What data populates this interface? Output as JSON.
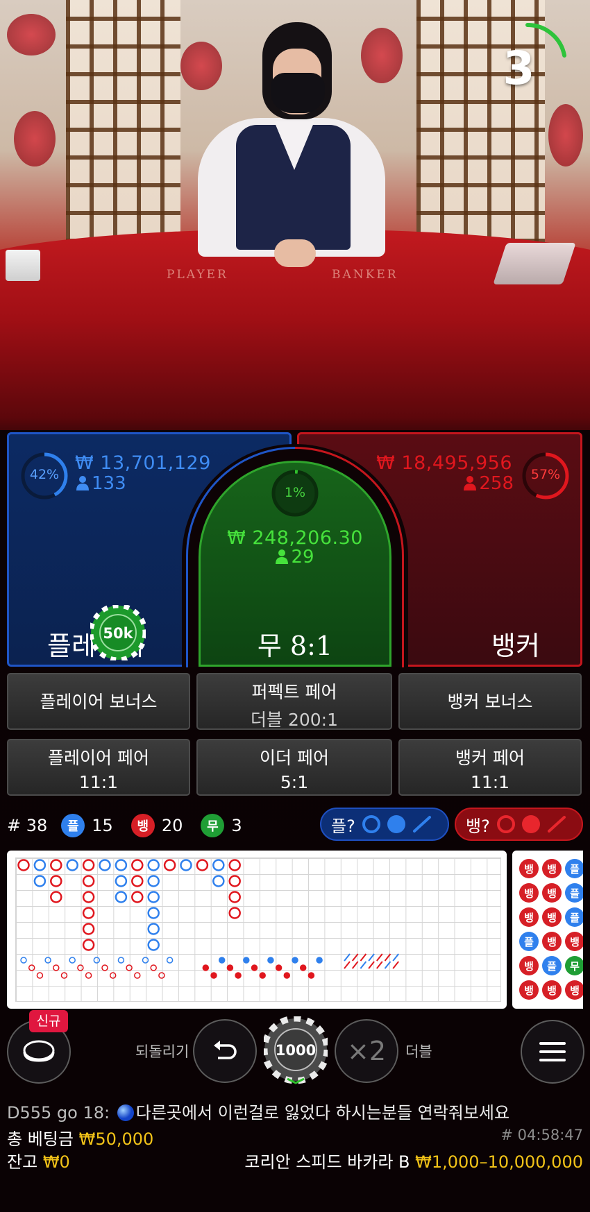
{
  "timer": {
    "seconds": "3",
    "progress_fraction": 0.22
  },
  "table_print": {
    "player": "PLAYER",
    "banker": "BANKER"
  },
  "player": {
    "percent": "42%",
    "percent_value": 42,
    "amount": "₩ 13,701,129",
    "bettors": "133",
    "label": "플레이어",
    "chip": "50k"
  },
  "tie": {
    "percent": "1%",
    "percent_value": 1,
    "amount": "₩ 248,206.30",
    "bettors": "29",
    "label": "무 8:1"
  },
  "banker": {
    "percent": "57%",
    "percent_value": 57,
    "amount": "₩ 18,495,956",
    "bettors": "258",
    "label": "뱅커"
  },
  "side_bets": [
    {
      "line1": "플레이어 보너스",
      "line2": ""
    },
    {
      "line1": "퍼펙트 페어",
      "line2": "더블 200:1"
    },
    {
      "line1": "뱅커 보너스",
      "line2": ""
    },
    {
      "line1": "플레이어 페어",
      "line2": "11:1"
    },
    {
      "line1": "이더 페어",
      "line2": "5:1"
    },
    {
      "line1": "뱅커 페어",
      "line2": "11:1"
    }
  ],
  "stats": {
    "round": "# 38",
    "player_badge": "플",
    "player_count": "15",
    "banker_badge": "뱅",
    "banker_count": "20",
    "tie_badge": "무",
    "tie_count": "3"
  },
  "prediction": {
    "player_label": "플?",
    "banker_label": "뱅?"
  },
  "bead_road": [
    [
      "뱅",
      "뱅",
      "플"
    ],
    [
      "뱅",
      "뱅",
      "플"
    ],
    [
      "뱅",
      "뱅",
      "플"
    ],
    [
      "플",
      "뱅",
      "뱅"
    ],
    [
      "뱅",
      "플",
      "무"
    ],
    [
      "뱅",
      "뱅",
      "뱅"
    ]
  ],
  "controls": {
    "new_badge": "신규",
    "undo": "되돌리기",
    "chip_value": "1000",
    "double_icon": "×2",
    "double": "더블"
  },
  "chat": {
    "user": "D555 go 18:",
    "message": "다른곳에서 이런걸로 잃었다 하시는분들 연락줘보세요"
  },
  "footer": {
    "total_label": "총 베팅금",
    "total_value": "₩50,000",
    "game_id": "# 04:58:47",
    "balance_label": "잔고",
    "balance_value": "₩0",
    "table_name": "코리안 스피드 바카라 B",
    "limits": "₩1,000–10,000,000"
  },
  "colors": {
    "player_blue": "#2f80ed",
    "banker_red": "#d61f26",
    "tie_green": "#2fa52c",
    "gold": "#f2c318"
  }
}
